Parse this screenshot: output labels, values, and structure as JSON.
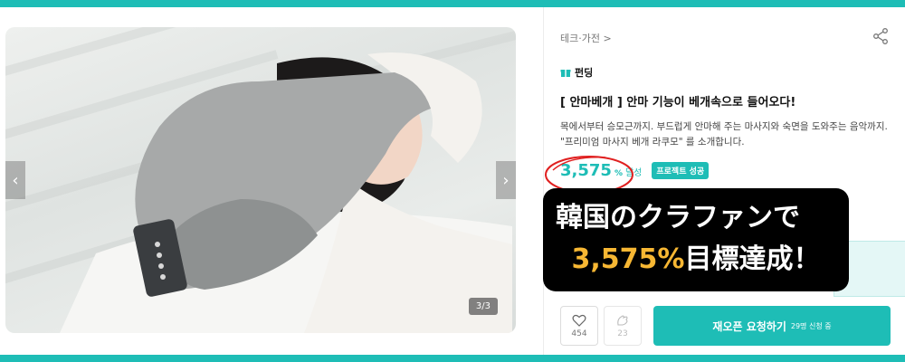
{
  "colors": {
    "accent": "#1ebdb6",
    "highlight": "#f7b733",
    "circle": "#e02020"
  },
  "gallery": {
    "counter": "3/3",
    "prev_icon": "chevron-left-icon",
    "next_icon": "chevron-right-icon",
    "prev_glyph": "‹",
    "next_glyph": "›"
  },
  "project": {
    "breadcrumb": "테크·가전 >",
    "tag": "펀딩",
    "title": "[ 안마베개 ] 안마 기능이 베개속으로 들어오다!",
    "description": "목에서부터 승모근까지. 부드럽게 안마해 주는 마사지와 숙면을 도와주는 음악까지. \"프리미엄 마사지 베개 라쿠모\" 를 소개합니다.",
    "achievement": "3,575",
    "achievement_unit": "%",
    "achievement_label": "달성",
    "success_badge": "프로젝트 성공"
  },
  "actions": {
    "like_count": "454",
    "cheer_count": "23",
    "reopen_label": "재오픈 요청하기",
    "reopen_sub": "29명 신청 중"
  },
  "banner": {
    "line1": "韓国のクラファンで",
    "line2_highlight": "3,575%",
    "line2_rest": "目標達成！"
  }
}
